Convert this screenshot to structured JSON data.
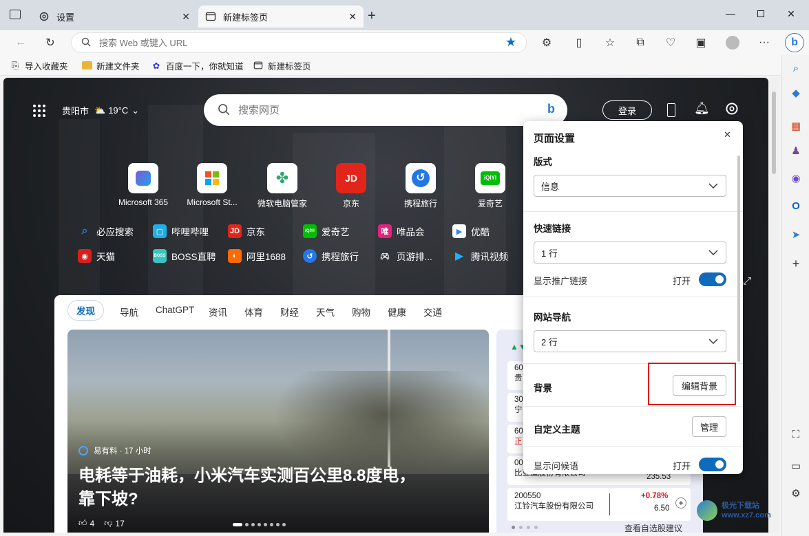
{
  "tabs": [
    {
      "label": "设置",
      "icon": "gear-icon"
    },
    {
      "label": "新建标签页",
      "icon": "newtab-icon"
    }
  ],
  "address": {
    "placeholder": "搜索 Web 或键入 URL"
  },
  "favorites": [
    {
      "label": "导入收藏夹",
      "icon": "import-icon"
    },
    {
      "label": "新建文件夹",
      "icon": "folder-icon"
    },
    {
      "label": "百度一下，你就知道",
      "icon": "baidu-icon"
    },
    {
      "label": "新建标签页",
      "icon": "newtab-icon"
    }
  ],
  "weather": {
    "city": "贵阳市",
    "temp": "19°C"
  },
  "search": {
    "placeholder": "搜索网页"
  },
  "login_label": "登录",
  "tiles": [
    {
      "label": "Microsoft 365",
      "color": "#7b5cd6"
    },
    {
      "label": "Microsoft St...",
      "color": "#0078d4"
    },
    {
      "label": "微软电脑管家",
      "color": "#2fa86f"
    },
    {
      "label": "京东",
      "color": "#e1251b",
      "text": "JD"
    },
    {
      "label": "携程旅行",
      "color": "#2577e3"
    },
    {
      "label": "爱奇艺",
      "color": "#00be06",
      "text": "iQIYI"
    }
  ],
  "quick_links_row1": [
    {
      "label": "必应搜索",
      "color": "#0f6cbd",
      "icon": "search-icon"
    },
    {
      "label": "哔哩哔哩",
      "color": "#23ade5",
      "icon": "bilibili-icon"
    },
    {
      "label": "京东",
      "color": "#e1251b",
      "text": "JD"
    },
    {
      "label": "爱奇艺",
      "color": "#00be06",
      "text": "iQIYI"
    },
    {
      "label": "唯品会",
      "color": "#e3227e",
      "text": "唯"
    },
    {
      "label": "优酷",
      "color": "#1f8cfa",
      "icon": "youku-icon"
    }
  ],
  "quick_links_row2": [
    {
      "label": "天猫",
      "color": "#d8201a",
      "icon": "tmall-icon"
    },
    {
      "label": "BOSS直聘",
      "color": "#38c5c0",
      "text": "BOSS"
    },
    {
      "label": "阿里1688",
      "color": "#ff6a00",
      "icon": "alibaba-icon"
    },
    {
      "label": "携程旅行",
      "color": "#2577e3",
      "icon": "ctrip-icon"
    },
    {
      "label": "页游排...",
      "color": "#7c7c7c",
      "icon": "gamepad-icon"
    },
    {
      "label": "腾讯视频",
      "color": "#1fb0ff",
      "icon": "tencent-video-icon"
    }
  ],
  "feed_tabs": [
    "发现",
    "导航",
    "ChatGPT",
    "资讯",
    "体育",
    "财经",
    "天气",
    "购物",
    "健康",
    "交通"
  ],
  "hero": {
    "source": "易有料 · 17 小时",
    "title_line1": "电耗等于油耗，小米汽车实测百公里8.8度电，",
    "title_line2": "靠下坡?",
    "likes": "4",
    "dislikes": "17"
  },
  "stocks": [
    {
      "code": "60",
      "name": "贵"
    },
    {
      "code": "30",
      "name": "宁"
    },
    {
      "code": "60",
      "name": "正"
    },
    {
      "code": "00",
      "name": "比亚迪股份有限公司",
      "price": "235.53"
    },
    {
      "code": "200550",
      "name": "江铃汽车股份有限公司",
      "change": "+0.78%",
      "price": "6.50"
    }
  ],
  "stocks_footer": "查看自选股建议",
  "settings": {
    "title": "页面设置",
    "layout_label": "版式",
    "layout_value": "信息",
    "quicklinks_label": "快速链接",
    "quicklinks_value": "1 行",
    "promo_label": "显示推广链接",
    "promo_state": "打开",
    "sitenav_label": "网站导航",
    "sitenav_value": "2 行",
    "bg_label": "背景",
    "bg_button": "编辑背景",
    "theme_label": "自定义主题",
    "theme_button": "管理",
    "greeting_label": "显示问候语",
    "greeting_state": "打开"
  },
  "colors": {
    "accent": "#0f6cbd",
    "highlight": "#e0141c"
  },
  "watermark": "极光下载站 www.xz7.com"
}
